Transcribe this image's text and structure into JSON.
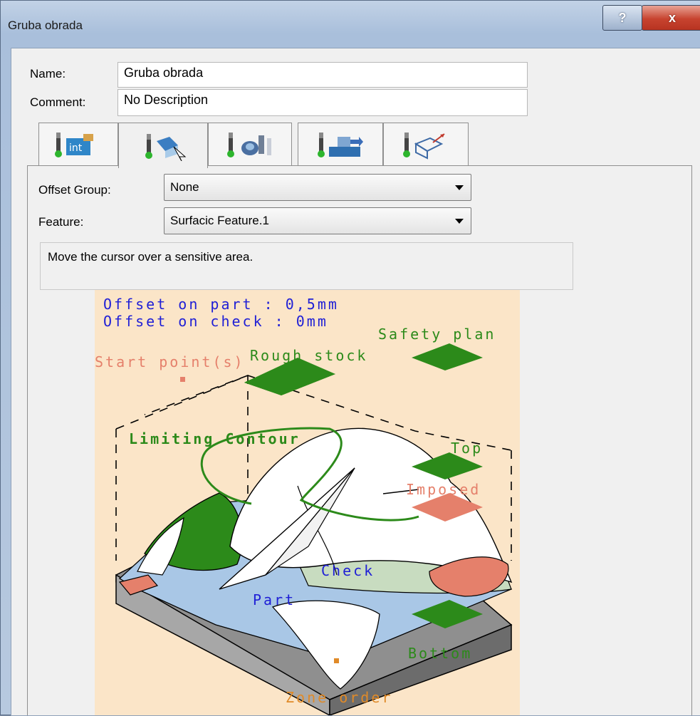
{
  "window": {
    "title": "Gruba obrada",
    "help_glyph": "?",
    "close_glyph": "x"
  },
  "form": {
    "name_label": "Name:",
    "name_value": "Gruba obrada",
    "comment_label": "Comment:",
    "comment_value": "No Description"
  },
  "tabs": [
    {
      "icon": "strategy-icon"
    },
    {
      "icon": "geometry-icon"
    },
    {
      "icon": "tool-icon"
    },
    {
      "icon": "feeds-speeds-icon"
    },
    {
      "icon": "macros-icon"
    }
  ],
  "geometry_tab": {
    "offset_group_label": "Offset Group:",
    "offset_group_value": "None",
    "feature_label": "Feature:",
    "feature_value": "Surfacic Feature.1",
    "info_text": "Move the cursor over a sensitive area."
  },
  "diagram": {
    "offset_part": "Offset on part : 0,5mm",
    "offset_check": "Offset on check : 0mm",
    "safety_plan": "Safety plan",
    "start_points": "Start point(s)",
    "rough_stock": "Rough stock",
    "limiting_contour": "Limiting Contour",
    "top": "Top",
    "imposed": "Imposed",
    "check": "Check",
    "part": "Part",
    "bottom": "Bottom",
    "zone_order": "Zone order",
    "colors": {
      "background": "#fbe5c8",
      "blue_text": "#1f1fd6",
      "green": "#2c8a1a",
      "salmon": "#e5806b",
      "orange": "#e08a28"
    }
  }
}
